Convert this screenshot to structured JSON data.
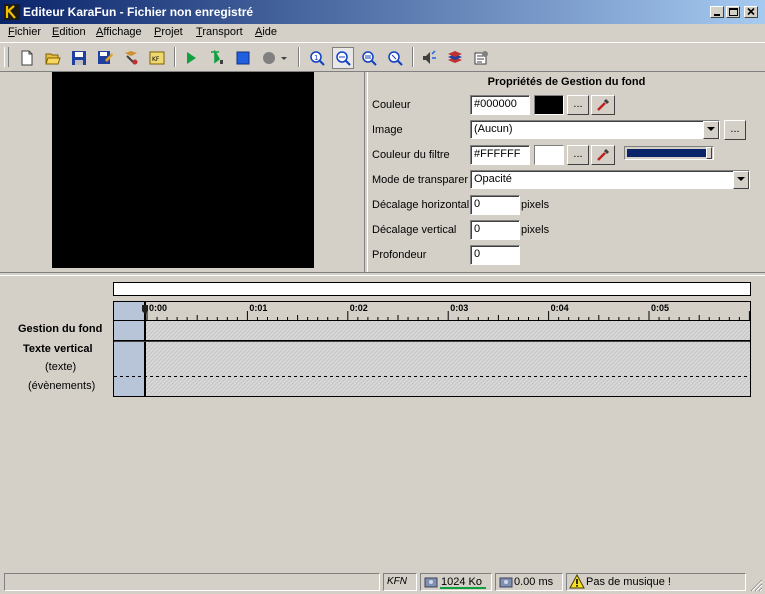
{
  "window": {
    "title": "Editeur KaraFun - Fichier non enregistré"
  },
  "menu": {
    "items": [
      {
        "label": "Fichier",
        "accel": "F",
        "rest": "ichier"
      },
      {
        "label": "Edition",
        "accel": "E",
        "rest": "dition"
      },
      {
        "label": "Affichage",
        "accel": "A",
        "rest": "ffichage"
      },
      {
        "label": "Projet",
        "accel": "P",
        "rest": "rojet"
      },
      {
        "label": "Transport",
        "accel": "T",
        "rest": "ransport"
      },
      {
        "label": "Aide",
        "accel": "A",
        "rest": "ide"
      }
    ]
  },
  "toolbar": {
    "icons": [
      "new-file-icon",
      "open-folder-icon",
      "save-icon",
      "save-as-icon",
      "properties-icon",
      "export-icon",
      "play-icon",
      "play-from-cursor-icon",
      "stop-icon",
      "record-icon",
      "dropdown-icon",
      "zoom-1-icon",
      "zoom-fit-icon",
      "zoom-in-icon",
      "zoom-out-icon",
      "audio-icon",
      "layers-icon",
      "settings-icon"
    ]
  },
  "properties": {
    "title": "Propriétés de Gestion du fond",
    "couleur_label": "Couleur",
    "couleur_value": "#000000",
    "couleur_swatch": "#000000",
    "image_label": "Image",
    "image_value": "(Aucun)",
    "filtre_label": "Couleur du filtre",
    "filtre_value": "#FFFFFF",
    "filtre_swatch": "#FFFFFF",
    "mode_label": "Mode de transparer",
    "mode_value": "Opacité",
    "dec_h_label": "Décalage horizontal",
    "dec_h_value": "0",
    "dec_v_label": "Décalage vertical",
    "dec_v_value": "0",
    "pixels": "pixels",
    "profondeur_label": "Profondeur",
    "profondeur_value": "0",
    "browse": "..."
  },
  "timeline": {
    "ticks": [
      "0:00",
      "0:01",
      "0:02",
      "0:03",
      "0:04",
      "0:05"
    ],
    "tracks": {
      "gestion": "Gestion du fond",
      "texte_vertical": "Texte vertical",
      "texte": "(texte)",
      "evenements": "(évènements)"
    }
  },
  "status": {
    "format": "KFN",
    "size": "1024 Ko",
    "time": "0.00 ms",
    "music": "Pas de musique !"
  }
}
